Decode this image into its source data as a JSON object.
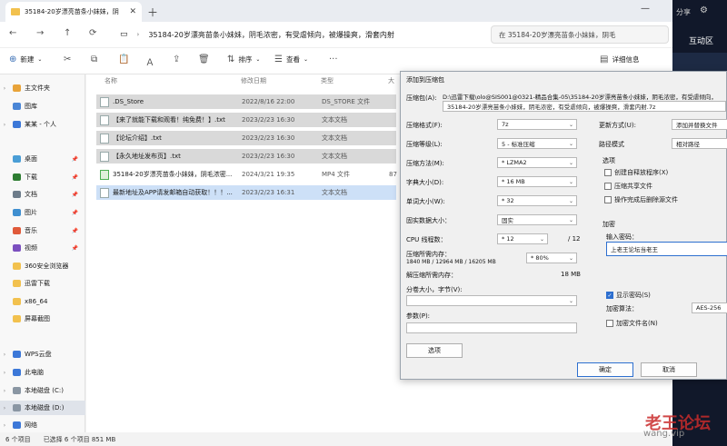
{
  "tab": {
    "title": "35184-20岁漂亮苗条小妹妹，阴"
  },
  "address": {
    "path": "35184-20岁漂亮苗条小妹妹，阴毛浓密，有受虐倾向，被爆操爽，滑套内射"
  },
  "search": {
    "placeholder": "在 35184-20岁漂亮苗条小妹妹，阴毛"
  },
  "toolbar": {
    "new": "新建",
    "sort": "排序",
    "view": "查看",
    "details": "详细信息"
  },
  "sidebar": {
    "items": [
      {
        "label": "主文件夹",
        "color": "#e8a33a"
      },
      {
        "label": "图库",
        "color": "#4a86d6"
      },
      {
        "label": "某某 - 个人",
        "color": "#3c78d8"
      },
      {
        "label": "桌面",
        "color": "#4a9ed6"
      },
      {
        "label": "下载",
        "color": "#2e7d32"
      },
      {
        "label": "文档",
        "color": "#6d7c8a"
      },
      {
        "label": "图片",
        "color": "#3f8fd0"
      },
      {
        "label": "音乐",
        "color": "#e05a3a"
      },
      {
        "label": "视频",
        "color": "#7b4fbf"
      },
      {
        "label": "360安全浏览器",
        "color": "#f2c14e"
      },
      {
        "label": "迅雷下载",
        "color": "#f2c14e"
      },
      {
        "label": "x86_64",
        "color": "#f2c14e"
      },
      {
        "label": "屏幕截图",
        "color": "#f2c14e"
      },
      {
        "label": "WPS云盘",
        "color": "#3c78d8"
      },
      {
        "label": "此电脑",
        "color": "#3c78d8"
      },
      {
        "label": "本地磁盘 (C:)",
        "color": "#8a96a3"
      },
      {
        "label": "本地磁盘 (D:)",
        "color": "#8a96a3"
      },
      {
        "label": "网络",
        "color": "#3c78d8"
      }
    ]
  },
  "columns": {
    "name": "名称",
    "date": "修改日期",
    "type": "类型",
    "size": "大"
  },
  "files": [
    {
      "name": ".DS_Store",
      "date": "2022/8/16 22:00",
      "type": "DS_STORE 文件",
      "size": ""
    },
    {
      "name": "【来了就能下载和观看！纯免费！】.txt",
      "date": "2023/2/23 16:30",
      "type": "文本文档",
      "size": ""
    },
    {
      "name": "【论坛介绍】.txt",
      "date": "2023/2/23 16:30",
      "type": "文本文档",
      "size": ""
    },
    {
      "name": "【永久地址发布页】.txt",
      "date": "2023/2/23 16:30",
      "type": "文本文档",
      "size": ""
    },
    {
      "name": "35184-20岁漂亮苗条小妹妹，阴毛浓密...",
      "date": "2024/3/21 19:35",
      "type": "MP4 文件",
      "size": "87"
    },
    {
      "name": "最新地址及APP请发邮箱自动获取！！！...",
      "date": "2023/2/23 16:31",
      "type": "文本文档",
      "size": ""
    }
  ],
  "status": {
    "count": "6 个项目",
    "selected": "已选择 6 个项目 851 MB"
  },
  "right": {
    "share": "分享",
    "interact": "互动区"
  },
  "dialog": {
    "title": "添加到压缩包",
    "archive_label": "压缩包(A):",
    "archive_path_1": "D:\\迅雷下载\\olo@SIS001@0321-精品合集-05\\35184-20岁漂亮苗条小妹妹，阴毛浓密，有受虐倾向，",
    "archive_path_2": "35184-20岁漂亮苗条小妹妹，阴毛浓密，有受虐倾向，被爆操爽，滑套内射.7z",
    "format_label": "压缩格式(F):",
    "format": "7z",
    "level_label": "压缩等级(L):",
    "level": "5 - 标准压缩",
    "method_label": "压缩方法(M):",
    "method": "* LZMA2",
    "dict_label": "字典大小(D):",
    "dict": "* 16 MB",
    "word_label": "单词大小(W):",
    "word": "* 32",
    "solid_label": "固实数据大小：",
    "solid": "固实",
    "cpu_label": "CPU 线程数：",
    "cpu": "* 12",
    "cpu_max": "/ 12",
    "mem_label": "压缩所需内存：",
    "mem_detail": "1840 MB / 12964 MB / 16205 MB",
    "mem_pct": "* 80%",
    "decomp_label": "解压缩所需内存：",
    "decomp": "18 MB",
    "volume_label": "分卷大小，字节(V):",
    "params_label": "参数(P):",
    "options_btn": "选项",
    "update_label": "更新方式(U):",
    "update": "添加并替换文件",
    "path_label": "路径模式",
    "path_mode": "相对路径",
    "options_group": "选项",
    "opt_sfx": "创建自释放程序(X)",
    "opt_shared": "压缩共享文件",
    "opt_delete": "操作完成后删除源文件",
    "encrypt_group": "加密",
    "password_label": "输入密码：",
    "password": "上老王论坛当老王",
    "show_pw": "显示密码(S)",
    "enc_method_label": "加密算法：",
    "enc_method": "AES-256",
    "enc_names": "加密文件名(N)",
    "ok": "确定",
    "cancel": "取消"
  },
  "watermark": {
    "main": "老王论坛",
    "url": "wang.vip"
  }
}
